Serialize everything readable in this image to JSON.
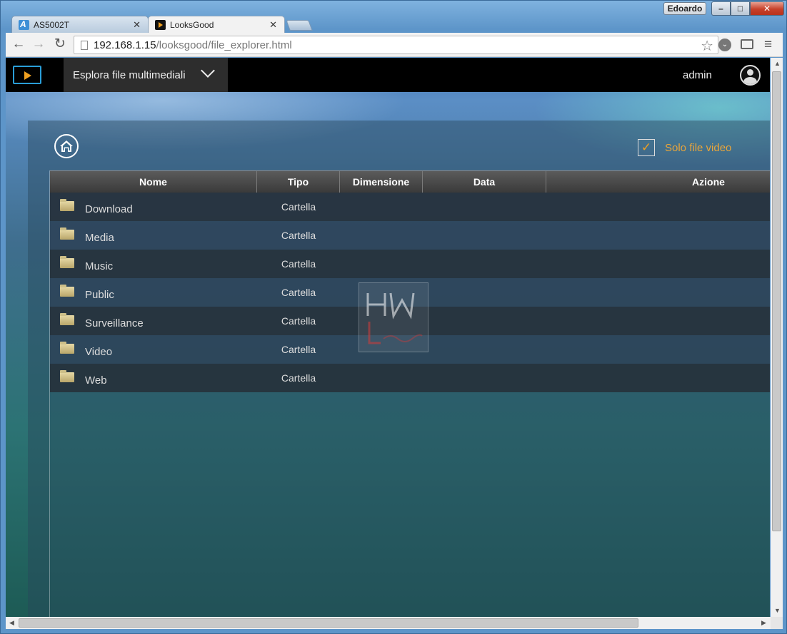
{
  "window": {
    "user_badge": "Edoardo",
    "minimize": "–",
    "maximize": "□",
    "close": "✕"
  },
  "tabs": [
    {
      "title": "AS5002T",
      "active": false
    },
    {
      "title": "LooksGood",
      "active": true
    }
  ],
  "toolbar": {
    "back": "←",
    "forward": "→",
    "reload": "↻",
    "url_host": "192.168.1.15",
    "url_path": "/looksgood/file_explorer.html",
    "star": "☆",
    "menu": "≡"
  },
  "app": {
    "section_menu_label": "Esplora file multimediali",
    "username": "admin"
  },
  "filter": {
    "checked": true,
    "check_mark": "✓",
    "label": "Solo file video"
  },
  "table": {
    "columns": [
      "Nome",
      "Tipo",
      "Dimensione",
      "Data",
      "Azione"
    ],
    "rows": [
      {
        "name": "Download",
        "type": "Cartella",
        "size": "",
        "date": "",
        "action": ""
      },
      {
        "name": "Media",
        "type": "Cartella",
        "size": "",
        "date": "",
        "action": ""
      },
      {
        "name": "Music",
        "type": "Cartella",
        "size": "",
        "date": "",
        "action": ""
      },
      {
        "name": "Public",
        "type": "Cartella",
        "size": "",
        "date": "",
        "action": ""
      },
      {
        "name": "Surveillance",
        "type": "Cartella",
        "size": "",
        "date": "",
        "action": ""
      },
      {
        "name": "Video",
        "type": "Cartella",
        "size": "",
        "date": "",
        "action": ""
      },
      {
        "name": "Web",
        "type": "Cartella",
        "size": "",
        "date": "",
        "action": ""
      }
    ]
  },
  "colors": {
    "accent_orange": "#f0a020",
    "header_bg": "#000000",
    "logo_blue": "#2a9ed8"
  }
}
